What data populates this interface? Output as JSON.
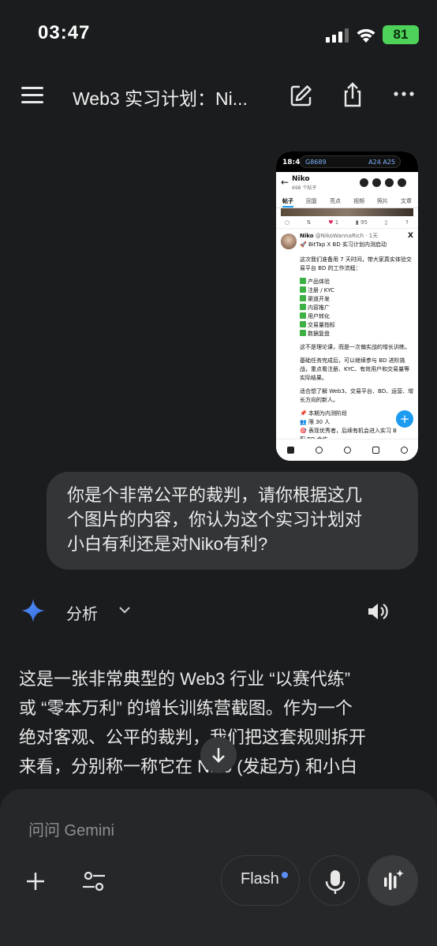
{
  "status": {
    "time": "03:47",
    "battery": "81"
  },
  "header": {
    "title": "Web3 实习计划：Ni..."
  },
  "thumbnail": {
    "status_time": "18:46",
    "island_left": "G8689",
    "island_right": "A24 A25",
    "profile_name": "Niko",
    "profile_sub": "698 个帖子",
    "tabs": [
      "帖子",
      "回复",
      "亮点",
      "视频",
      "照片",
      "文章"
    ],
    "actions": {
      "likes": "1",
      "views": "95"
    },
    "post_author": "Niko",
    "post_handle": "@NikoWannaRich · 1天",
    "post_title": "🚀 BitTap X BD 实习计划内测启动",
    "intro_lines": [
      "这次我们准备用 7 天时间，带大家真实体验交",
      "易平台 BD 的工作流程："
    ],
    "checklist": [
      "产品体验",
      "注册 / KYC",
      "渠道开发",
      "内容推广",
      "用户转化",
      "交易量指标",
      "数据复盘"
    ],
    "para1": "这不是理论课，而是一次偏实战的增长训练。",
    "para2_lines": [
      "基础任务完成后，可以继续参与 BD 进阶挑",
      "战，重点看注册、KYC、有效用户和交易量等",
      "实际结果。"
    ],
    "para3_lines": [
      "适合想了解 Web3、交易平台、BD、运营、增",
      "长方向的新人。"
    ],
    "footer_lines": [
      "📌 本期为内测阶段",
      "👥 限 30 人",
      "🎯 表现优秀者，后续有机会进入实习 B",
      "职 BD 合作"
    ]
  },
  "user_message": {
    "lines": [
      "你是个非常公平的裁判，请你根据这几",
      "个图片的内容，你认为这个实习计划对",
      "小白有利还是对Niko有利?"
    ]
  },
  "analysis": {
    "label": "分析"
  },
  "answer": {
    "lines": [
      "这是一张非常典型的 Web3 行业 “以赛代练”",
      "或 “零本万利” 的增长训练营截图。作为一个",
      "绝对客观、公平的裁判，我们把这套规则拆开",
      "来看，分别称一称它在 Niko (发起方) 和小白"
    ]
  },
  "composer": {
    "placeholder": "问问 Gemini",
    "model_label": "Flash"
  },
  "colors": {
    "accent_blue": "#5a8df5",
    "battery_green": "#4fd25a",
    "background": "#1b1c1e"
  }
}
